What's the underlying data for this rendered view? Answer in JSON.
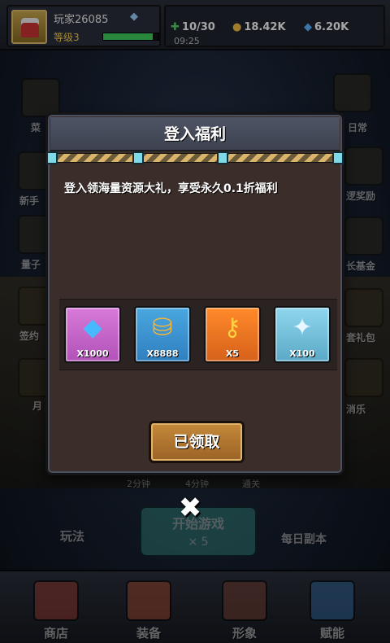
{
  "hud": {
    "player_name": "玩家26085",
    "level_label": "等级3",
    "exp_fraction": 0.9,
    "clock": "09:25",
    "resources": [
      {
        "icon": "energy-icon",
        "value": "10/30"
      },
      {
        "icon": "coin-icon",
        "value": "18.42K"
      },
      {
        "icon": "diamond-icon",
        "value": "6.20K"
      }
    ]
  },
  "side_left": [
    "菜",
    "新手",
    "量子",
    "签约",
    "月"
  ],
  "side_right": [
    "日常",
    "逻奖励",
    "长基金",
    "套礼包",
    "消乐"
  ],
  "timers": [
    "2分钟",
    "4分钟",
    "通关"
  ],
  "buttons": {
    "play": "玩法",
    "start": "开始游戏",
    "start_cost": "× 5",
    "daily_dungeon": "每日副本"
  },
  "nav": [
    "商店",
    "装备",
    "形象",
    "赋能"
  ],
  "modal": {
    "title": "登入福利",
    "description": "登入领海量资源大礼，享受永久0.1折福利",
    "rewards": [
      {
        "icon": "diamond-icon",
        "qty": "X1000"
      },
      {
        "icon": "gold-barrel-icon",
        "qty": "X8888"
      },
      {
        "icon": "key-icon",
        "qty": "X5"
      },
      {
        "icon": "puzzle-piece-icon",
        "qty": "X100"
      }
    ],
    "claim_label": "已领取"
  },
  "colors": {
    "modal_bg": "#3b2e2a",
    "claim_button": "#b57834",
    "header": "#4e5464"
  }
}
